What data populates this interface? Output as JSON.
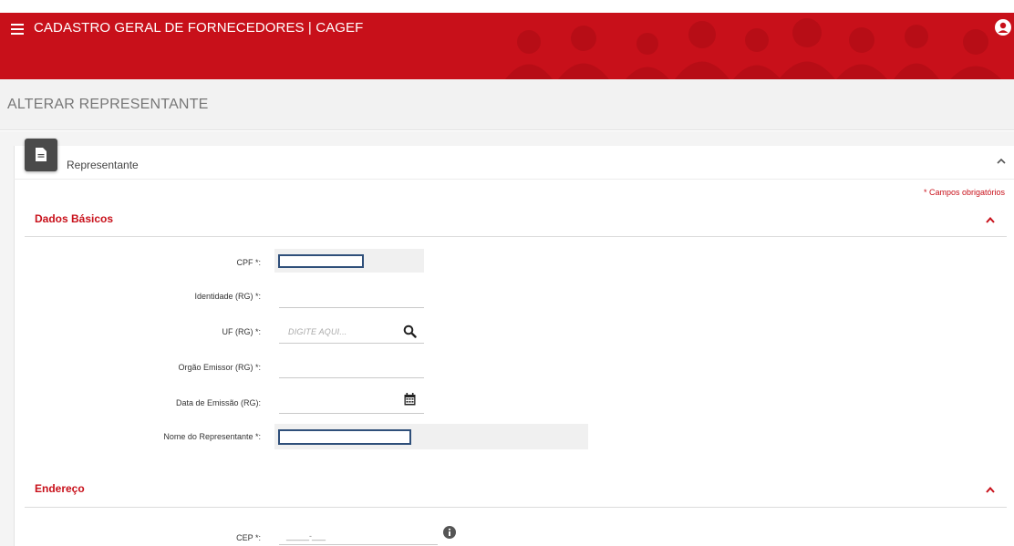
{
  "header": {
    "title": "CADASTRO GERAL DE FORNECEDORES | CAGEF",
    "brand_color": "#c8101a"
  },
  "page": {
    "title": "ALTERAR REPRESENTANTE"
  },
  "card": {
    "title": "Representante",
    "required_note": "* Campos obrigatórios"
  },
  "sections": {
    "dados_basicos": "Dados Básicos",
    "endereco": "Endereço"
  },
  "form": {
    "cpf_label": "CPF *:",
    "rg_label": "Identidade (RG) *:",
    "uf_label": "UF (RG) *:",
    "uf_placeholder": "DIGITE AQUI...",
    "orgao_label": "Orgão Emissor (RG) *:",
    "data_label": "Data de Emissão (RG):",
    "nome_label": "Nome do Representante *:",
    "cep_label": "CEP *:",
    "cep_placeholder": "_____-___"
  },
  "icons": {
    "menu": "hamburger-icon",
    "user": "user-circle-icon",
    "document": "document-icon",
    "search": "search-icon",
    "calendar": "calendar-icon",
    "info": "info-icon",
    "collapse": "chevron-up-icon"
  }
}
